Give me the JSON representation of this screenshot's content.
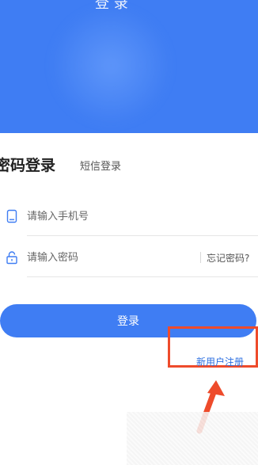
{
  "header": {
    "title": "登 录"
  },
  "tabs": {
    "password_login": "密码登录",
    "sms_login": "短信登录"
  },
  "phone": {
    "placeholder": "请输入手机号",
    "icon": "phone-icon"
  },
  "password": {
    "placeholder": "请输入密码",
    "icon": "lock-icon",
    "forgot_label": "忘记密码?"
  },
  "login_button": {
    "label": "登录"
  },
  "register": {
    "label": "新用户注册"
  },
  "colors": {
    "primary": "#3f7df3",
    "highlight": "#ee4b2b"
  }
}
